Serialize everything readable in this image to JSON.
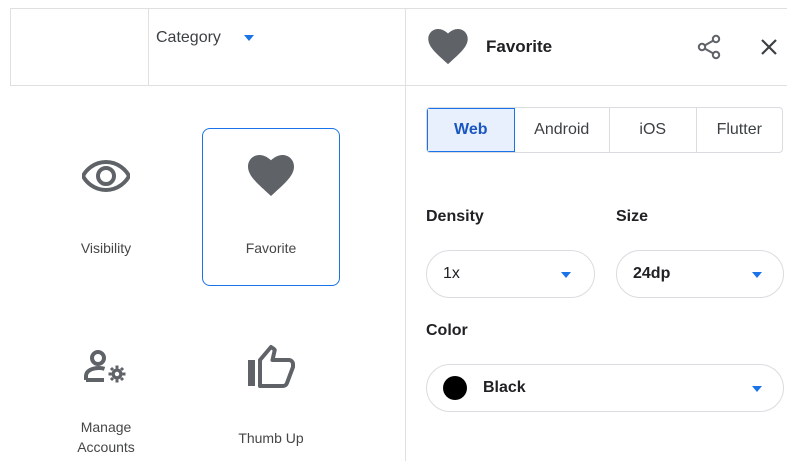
{
  "left": {
    "category_label": "Category",
    "icons": [
      {
        "label": "Visibility",
        "icon": "visibility-icon"
      },
      {
        "label": "Favorite",
        "icon": "favorite-icon"
      },
      {
        "label": "Manage\nAccounts",
        "icon": "manage-accounts-icon"
      },
      {
        "label": "Thumb Up",
        "icon": "thumb-up-icon"
      }
    ],
    "selected": "Favorite"
  },
  "detail": {
    "title": "Favorite",
    "title_icon": "favorite-icon",
    "tabs": [
      "Web",
      "Android",
      "iOS",
      "Flutter"
    ],
    "active_tab": "Web",
    "density_label": "Density",
    "density_value": "1x",
    "size_label": "Size",
    "size_value": "24dp",
    "color_label": "Color",
    "color_value": "Black",
    "color_hex": "#000000"
  },
  "colors": {
    "accent": "#1a73e8",
    "icon_gray": "#5f6368",
    "tab_active_bg": "#e8f0fe"
  }
}
